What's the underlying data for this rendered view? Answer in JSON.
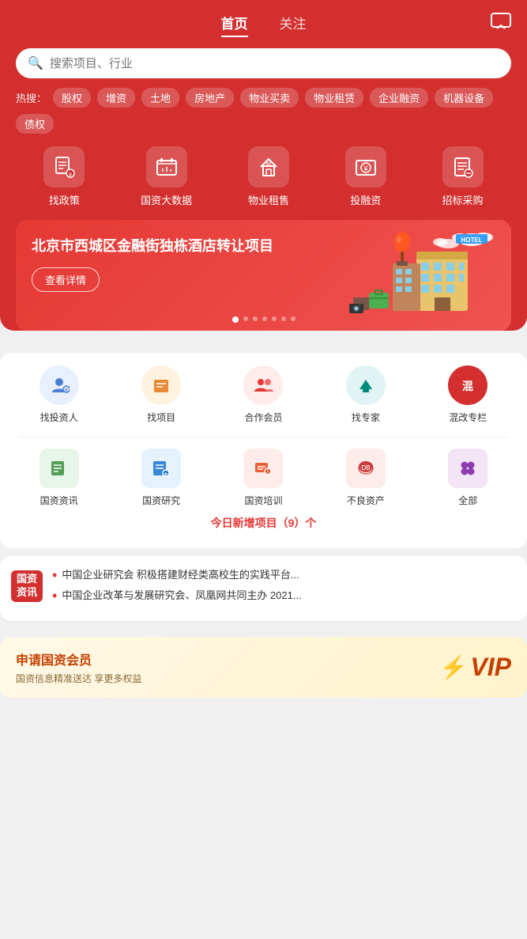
{
  "header": {
    "nav_tab_home": "首页",
    "nav_tab_follow": "关注",
    "msg_icon": "💬"
  },
  "search": {
    "placeholder": "搜索项目、行业"
  },
  "hot_tags": {
    "label": "热搜：",
    "tags": [
      "股权",
      "增资",
      "土地",
      "房地产",
      "物业买卖",
      "物业租赁",
      "企业融资",
      "机器设备",
      "债权"
    ]
  },
  "quick_nav": [
    {
      "id": "policy",
      "icon": "📋",
      "label": "找政策"
    },
    {
      "id": "bigdata",
      "icon": "🏛",
      "label": "国资大数据"
    },
    {
      "id": "rental",
      "icon": "🏠",
      "label": "物业租售"
    },
    {
      "id": "invest",
      "icon": "💰",
      "label": "投融资"
    },
    {
      "id": "bid",
      "icon": "📑",
      "label": "招标采购"
    }
  ],
  "banner": {
    "title": "北京市西城区金融街独栋酒店转让项目",
    "btn_label": "查看详情",
    "dots": 7,
    "active_dot": 0
  },
  "services": [
    {
      "id": "investor",
      "color": "blue",
      "label": "找投资人"
    },
    {
      "id": "project",
      "color": "orange",
      "label": "找项目"
    },
    {
      "id": "member",
      "color": "red",
      "label": "合作会员"
    },
    {
      "id": "expert",
      "color": "teal",
      "label": "找专家"
    },
    {
      "id": "mixed",
      "color": "redsolid",
      "label": "混改专栏"
    }
  ],
  "resources": [
    {
      "id": "news",
      "color": "green",
      "label": "国资资讯"
    },
    {
      "id": "research",
      "color": "blue",
      "label": "国资研究"
    },
    {
      "id": "training",
      "color": "orange",
      "label": "国资培训"
    },
    {
      "id": "bad-asset",
      "color": "red",
      "label": "不良资产"
    },
    {
      "id": "all",
      "color": "purple",
      "label": "全部"
    }
  ],
  "today_projects": {
    "label": "今日新增项目（9）个"
  },
  "news": {
    "badge_line1": "国资",
    "badge_line2": "资讯",
    "items": [
      {
        "text": "中国企业研究会 积极搭建财经类高校生的实践平台..."
      },
      {
        "text": "中国企业改革与发展研究会、凤凰网共同主办 2021..."
      }
    ]
  },
  "vip": {
    "title": "申请国资会员",
    "desc": "国资信息精准送达 享更多权益",
    "badge_text": "VIP"
  }
}
